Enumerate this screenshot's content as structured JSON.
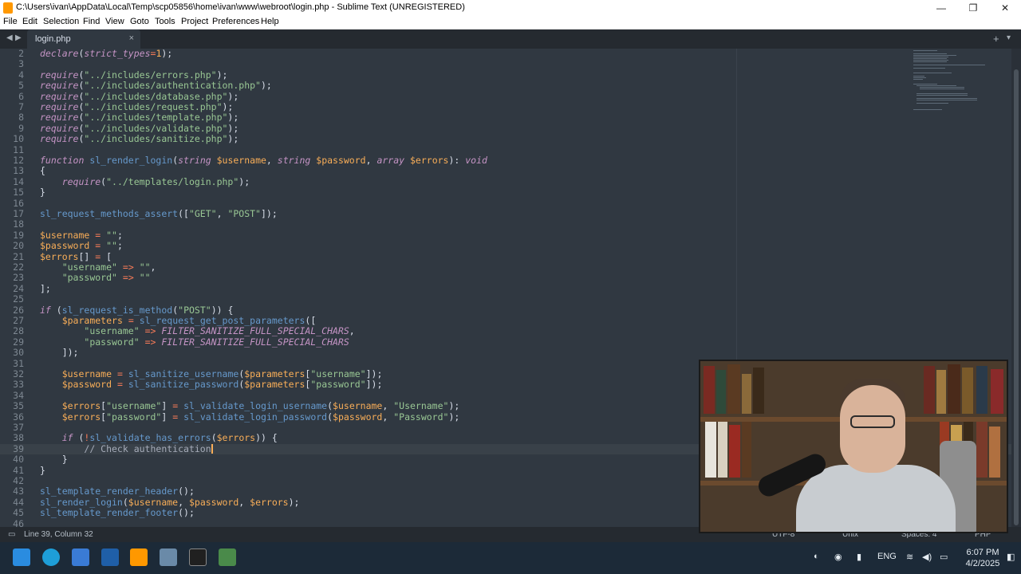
{
  "window": {
    "title": "C:\\Users\\ivan\\AppData\\Local\\Temp\\scp05856\\home\\ivan\\www\\webroot\\login.php - Sublime Text (UNREGISTERED)",
    "minimize": "—",
    "maximize": "❐",
    "close": "✕"
  },
  "menu": [
    "File",
    "Edit",
    "Selection",
    "Find",
    "View",
    "Goto",
    "Tools",
    "Project",
    "Preferences",
    "Help"
  ],
  "tabs": {
    "active": "login.php",
    "close": "×",
    "nav_back": "◀",
    "nav_forward": "▶",
    "new_tab": "+",
    "overflow": "▾"
  },
  "code_lines": [
    {
      "n": "2",
      "html": "<span class='kw'>declare</span>(<span class='kw'>strict_types</span><span class='op'>=</span><span class='va'>1</span>);"
    },
    {
      "n": "3",
      "html": ""
    },
    {
      "n": "4",
      "html": "<span class='kw'>require</span>(<span class='st'>\"../includes/errors.php\"</span>);"
    },
    {
      "n": "5",
      "html": "<span class='kw'>require</span>(<span class='st'>\"../includes/authentication.php\"</span>);"
    },
    {
      "n": "6",
      "html": "<span class='kw'>require</span>(<span class='st'>\"../includes/database.php\"</span>);"
    },
    {
      "n": "7",
      "html": "<span class='kw'>require</span>(<span class='st'>\"../includes/request.php\"</span>);"
    },
    {
      "n": "8",
      "html": "<span class='kw'>require</span>(<span class='st'>\"../includes/template.php\"</span>);"
    },
    {
      "n": "9",
      "html": "<span class='kw'>require</span>(<span class='st'>\"../includes/validate.php\"</span>);"
    },
    {
      "n": "10",
      "html": "<span class='kw'>require</span>(<span class='st'>\"../includes/sanitize.php\"</span>);"
    },
    {
      "n": "11",
      "html": ""
    },
    {
      "n": "12",
      "html": "<span class='kw'>function</span> <span class='fn'>sl_render_login</span>(<span class='ty'>string</span> <span class='va'>$username</span>, <span class='ty'>string</span> <span class='va'>$password</span>, <span class='ty'>array</span> <span class='va'>$errors</span>): <span class='ty'>void</span>"
    },
    {
      "n": "13",
      "html": "{"
    },
    {
      "n": "14",
      "html": "    <span class='kw'>require</span>(<span class='st'>\"../templates/login.php\"</span>);"
    },
    {
      "n": "15",
      "html": "}"
    },
    {
      "n": "16",
      "html": ""
    },
    {
      "n": "17",
      "html": "<span class='fn'>sl_request_methods_assert</span>([<span class='st'>\"GET\"</span>, <span class='st'>\"POST\"</span>]);"
    },
    {
      "n": "18",
      "html": ""
    },
    {
      "n": "19",
      "html": "<span class='va'>$username</span> <span class='op'>=</span> <span class='st'>\"\"</span>;"
    },
    {
      "n": "20",
      "html": "<span class='va'>$password</span> <span class='op'>=</span> <span class='st'>\"\"</span>;"
    },
    {
      "n": "21",
      "html": "<span class='va'>$errors</span>[] <span class='op'>=</span> ["
    },
    {
      "n": "22",
      "html": "    <span class='st'>\"username\"</span> <span class='op'>=></span> <span class='st'>\"\"</span>,"
    },
    {
      "n": "23",
      "html": "    <span class='st'>\"password\"</span> <span class='op'>=></span> <span class='st'>\"\"</span>"
    },
    {
      "n": "24",
      "html": "];"
    },
    {
      "n": "25",
      "html": ""
    },
    {
      "n": "26",
      "html": "<span class='kw'>if</span> (<span class='fn'>sl_request_is_method</span>(<span class='st'>\"POST\"</span>)) {"
    },
    {
      "n": "27",
      "html": "    <span class='va'>$parameters</span> <span class='op'>=</span> <span class='fn'>sl_request_get_post_parameters</span>(["
    },
    {
      "n": "28",
      "html": "        <span class='st'>\"username\"</span> <span class='op'>=></span> <span class='cst'>FILTER_SANITIZE_FULL_SPECIAL_CHARS</span>,"
    },
    {
      "n": "29",
      "html": "        <span class='st'>\"password\"</span> <span class='op'>=></span> <span class='cst'>FILTER_SANITIZE_FULL_SPECIAL_CHARS</span>"
    },
    {
      "n": "30",
      "html": "    ]);"
    },
    {
      "n": "31",
      "html": ""
    },
    {
      "n": "32",
      "html": "    <span class='va'>$username</span> <span class='op'>=</span> <span class='fn'>sl_sanitize_username</span>(<span class='va'>$parameters</span>[<span class='st'>\"username\"</span>]);"
    },
    {
      "n": "33",
      "html": "    <span class='va'>$password</span> <span class='op'>=</span> <span class='fn'>sl_sanitize_password</span>(<span class='va'>$parameters</span>[<span class='st'>\"password\"</span>]);"
    },
    {
      "n": "34",
      "html": ""
    },
    {
      "n": "35",
      "html": "    <span class='va'>$errors</span>[<span class='st'>\"username\"</span>] <span class='op'>=</span> <span class='fn'>sl_validate_login_username</span>(<span class='va'>$username</span>, <span class='st'>\"Username\"</span>);"
    },
    {
      "n": "36",
      "html": "    <span class='va'>$errors</span>[<span class='st'>\"password\"</span>] <span class='op'>=</span> <span class='fn'>sl_validate_login_password</span>(<span class='va'>$password</span>, <span class='st'>\"Password\"</span>);"
    },
    {
      "n": "37",
      "html": ""
    },
    {
      "n": "38",
      "html": "    <span class='kw'>if</span> (<span class='op'>!</span><span class='fn'>sl_validate_has_errors</span>(<span class='va'>$errors</span>)) {"
    },
    {
      "n": "39",
      "html": "        <span class='cm'>// Check authentication</span><span class='caret'></span>",
      "current": true
    },
    {
      "n": "40",
      "html": "    }"
    },
    {
      "n": "41",
      "html": "}"
    },
    {
      "n": "42",
      "html": ""
    },
    {
      "n": "43",
      "html": "<span class='fn'>sl_template_render_header</span>();"
    },
    {
      "n": "44",
      "html": "<span class='fn'>sl_render_login</span>(<span class='va'>$username</span>, <span class='va'>$password</span>, <span class='va'>$errors</span>);"
    },
    {
      "n": "45",
      "html": "<span class='fn'>sl_template_render_footer</span>();"
    },
    {
      "n": "46",
      "html": ""
    }
  ],
  "status": {
    "position": "Line 39, Column 32",
    "encoding": "UTF-8",
    "line_endings": "Unix",
    "indent": "Spaces: 4",
    "syntax": "PHP"
  },
  "taskbar": {
    "language": "ENG",
    "time": "6:07 PM",
    "date": "4/2/2025",
    "apps": [
      "windows-start",
      "edge",
      "visual-studio",
      "terminal-blue",
      "sublime-text",
      "calculator",
      "command-prompt",
      "tool"
    ]
  },
  "colors": {
    "editor_bg": "#303841",
    "keyword": "#c594c5",
    "function": "#6699cc",
    "string": "#99c794",
    "variable": "#f9ae58",
    "operator": "#f97b58",
    "comment": "#a6acb9"
  }
}
